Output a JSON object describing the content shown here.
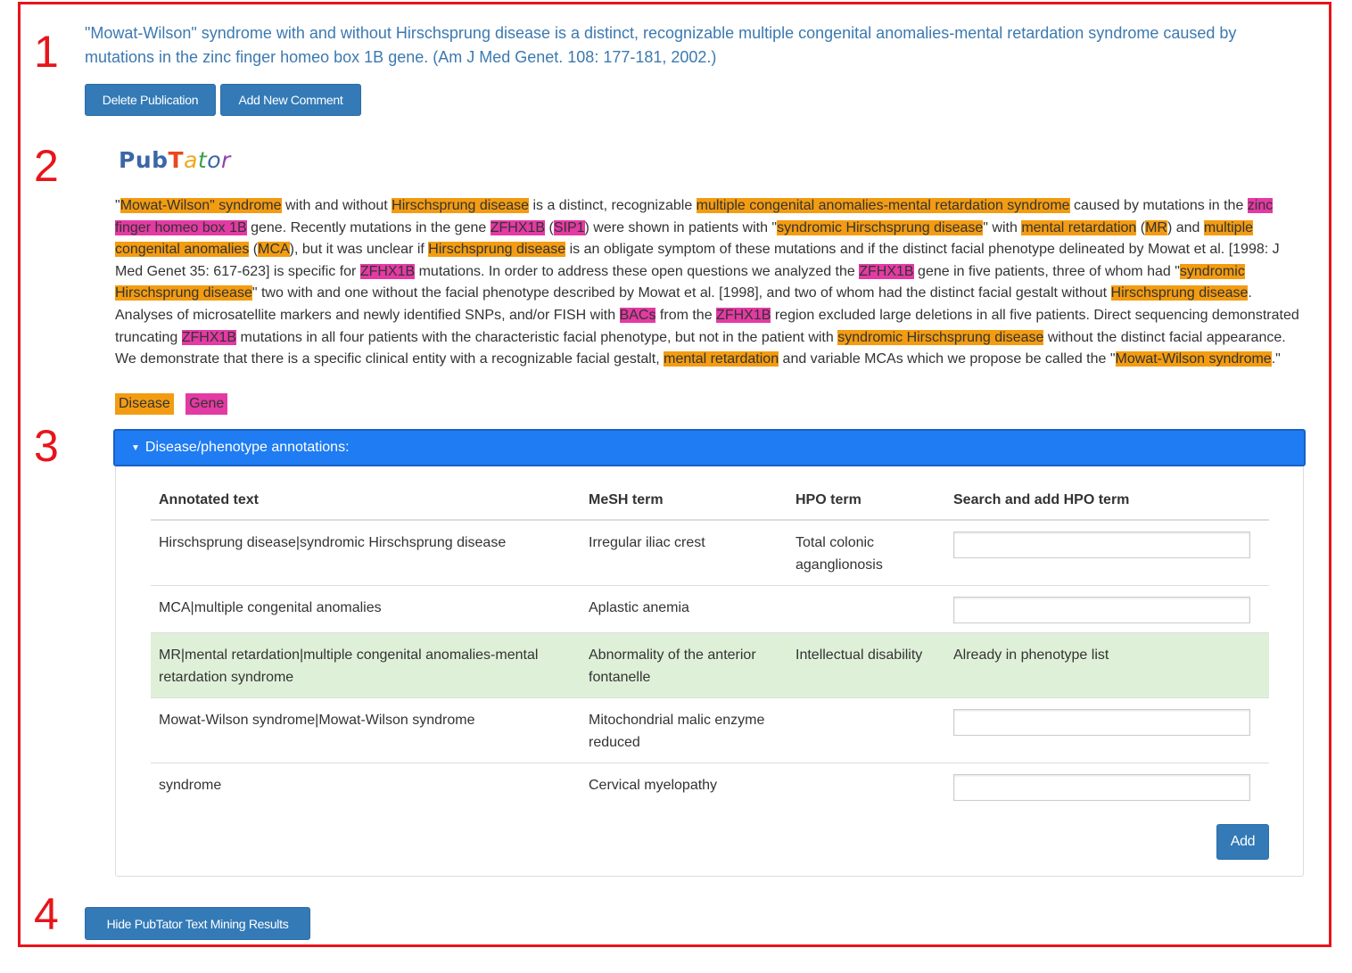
{
  "section_numbers": [
    "1",
    "2",
    "3",
    "4"
  ],
  "publication": {
    "title": "\"Mowat-Wilson\" syndrome with and without Hirschsprung disease is a distinct, recognizable multiple congenital anomalies-mental retardation syndrome caused by mutations in the zinc finger homeo box 1B gene. (Am J Med Genet. 108: 177-181, 2002.)",
    "delete_label": "Delete Publication",
    "comment_label": "Add New Comment"
  },
  "pubtator": {
    "logo_pub": "Pub",
    "logo_letters": [
      "T",
      "a",
      "t",
      "o",
      "r"
    ],
    "colors": {
      "disease": "#f39c12",
      "gene": "#e33aa3",
      "logo_blue": "#3b66a8"
    },
    "abstract_segments": [
      {
        "t": "\""
      },
      {
        "t": "Mowat-Wilson\" syndrome",
        "k": "d"
      },
      {
        "t": " with and without "
      },
      {
        "t": "Hirschsprung disease",
        "k": "d"
      },
      {
        "t": " is a distinct, recognizable "
      },
      {
        "t": "multiple congenital anomalies-mental retardation syndrome",
        "k": "d"
      },
      {
        "t": " caused by mutations in the "
      },
      {
        "t": "zinc finger homeo box 1B",
        "k": "g"
      },
      {
        "t": " gene. Recently mutations in the gene "
      },
      {
        "t": "ZFHX1B",
        "k": "g"
      },
      {
        "t": " ("
      },
      {
        "t": "SIP1",
        "k": "g"
      },
      {
        "t": ") were shown in patients with \""
      },
      {
        "t": "syndromic Hirschsprung disease",
        "k": "d"
      },
      {
        "t": "\" with "
      },
      {
        "t": "mental retardation",
        "k": "d"
      },
      {
        "t": " ("
      },
      {
        "t": "MR",
        "k": "d"
      },
      {
        "t": ") and "
      },
      {
        "t": "multiple congenital anomalies",
        "k": "d"
      },
      {
        "t": " ("
      },
      {
        "t": "MCA",
        "k": "d"
      },
      {
        "t": "), but it was unclear if "
      },
      {
        "t": "Hirschsprung disease",
        "k": "d"
      },
      {
        "t": " is an obligate symptom of these mutations and if the distinct facial phenotype delineated by Mowat et al. [1998: J Med Genet 35: 617-623] is specific for "
      },
      {
        "t": "ZFHX1B",
        "k": "g"
      },
      {
        "t": " mutations. In order to address these open questions we analyzed the "
      },
      {
        "t": "ZFHX1B",
        "k": "g"
      },
      {
        "t": " gene in five patients, three of whom had \""
      },
      {
        "t": "syndromic Hirschsprung disease",
        "k": "d"
      },
      {
        "t": "\" two with and one without the facial phenotype described by Mowat et al. [1998], and two of whom had the distinct facial gestalt without "
      },
      {
        "t": "Hirschsprung disease",
        "k": "d"
      },
      {
        "t": ". Analyses of microsatellite markers and newly identified SNPs, and/or FISH with "
      },
      {
        "t": "BACs",
        "k": "g"
      },
      {
        "t": " from the "
      },
      {
        "t": "ZFHX1B",
        "k": "g"
      },
      {
        "t": " region excluded large deletions in all five patients. Direct sequencing demonstrated truncating "
      },
      {
        "t": "ZFHX1B",
        "k": "g"
      },
      {
        "t": " mutations in all four patients with the characteristic facial phenotype, but not in the patient with "
      },
      {
        "t": "syndromic Hirschsprung disease",
        "k": "d"
      },
      {
        "t": " without the distinct facial appearance. We demonstrate that there is a specific clinical entity with a recognizable facial gestalt, "
      },
      {
        "t": "mental retardation",
        "k": "d"
      },
      {
        "t": " and variable MCAs which we propose be called the \""
      },
      {
        "t": "Mowat-Wilson syndrome",
        "k": "d"
      },
      {
        "t": ".\""
      }
    ],
    "legend": {
      "disease": "Disease",
      "gene": "Gene"
    }
  },
  "annotations": {
    "panel_title": "Disease/phenotype annotations:",
    "columns": [
      "Annotated text",
      "MeSH term",
      "HPO term",
      "Search and add HPO term"
    ],
    "rows": [
      {
        "text": "Hirschsprung disease|syndromic Hirschsprung disease",
        "mesh": "Irregular iliac crest",
        "hpo": "Total colonic aganglionosis",
        "status": "",
        "input_value": ""
      },
      {
        "text": "MCA|multiple congenital anomalies",
        "mesh": "Aplastic anemia",
        "hpo": "",
        "status": "",
        "input_value": ""
      },
      {
        "text": "MR|mental retardation|multiple congenital anomalies-mental retardation syndrome",
        "mesh": "Abnormality of the anterior fontanelle",
        "hpo": "Intellectual disability",
        "status": "Already in phenotype list",
        "input_value": ""
      },
      {
        "text": "Mowat-Wilson syndrome|Mowat-Wilson syndrome",
        "mesh": "Mitochondrial malic enzyme reduced",
        "hpo": "",
        "status": "",
        "input_value": ""
      },
      {
        "text": "syndrome",
        "mesh": "Cervical myelopathy",
        "hpo": "",
        "status": "",
        "input_value": ""
      }
    ],
    "add_label": "Add"
  },
  "hide_label": "Hide PubTator Text Mining Results"
}
